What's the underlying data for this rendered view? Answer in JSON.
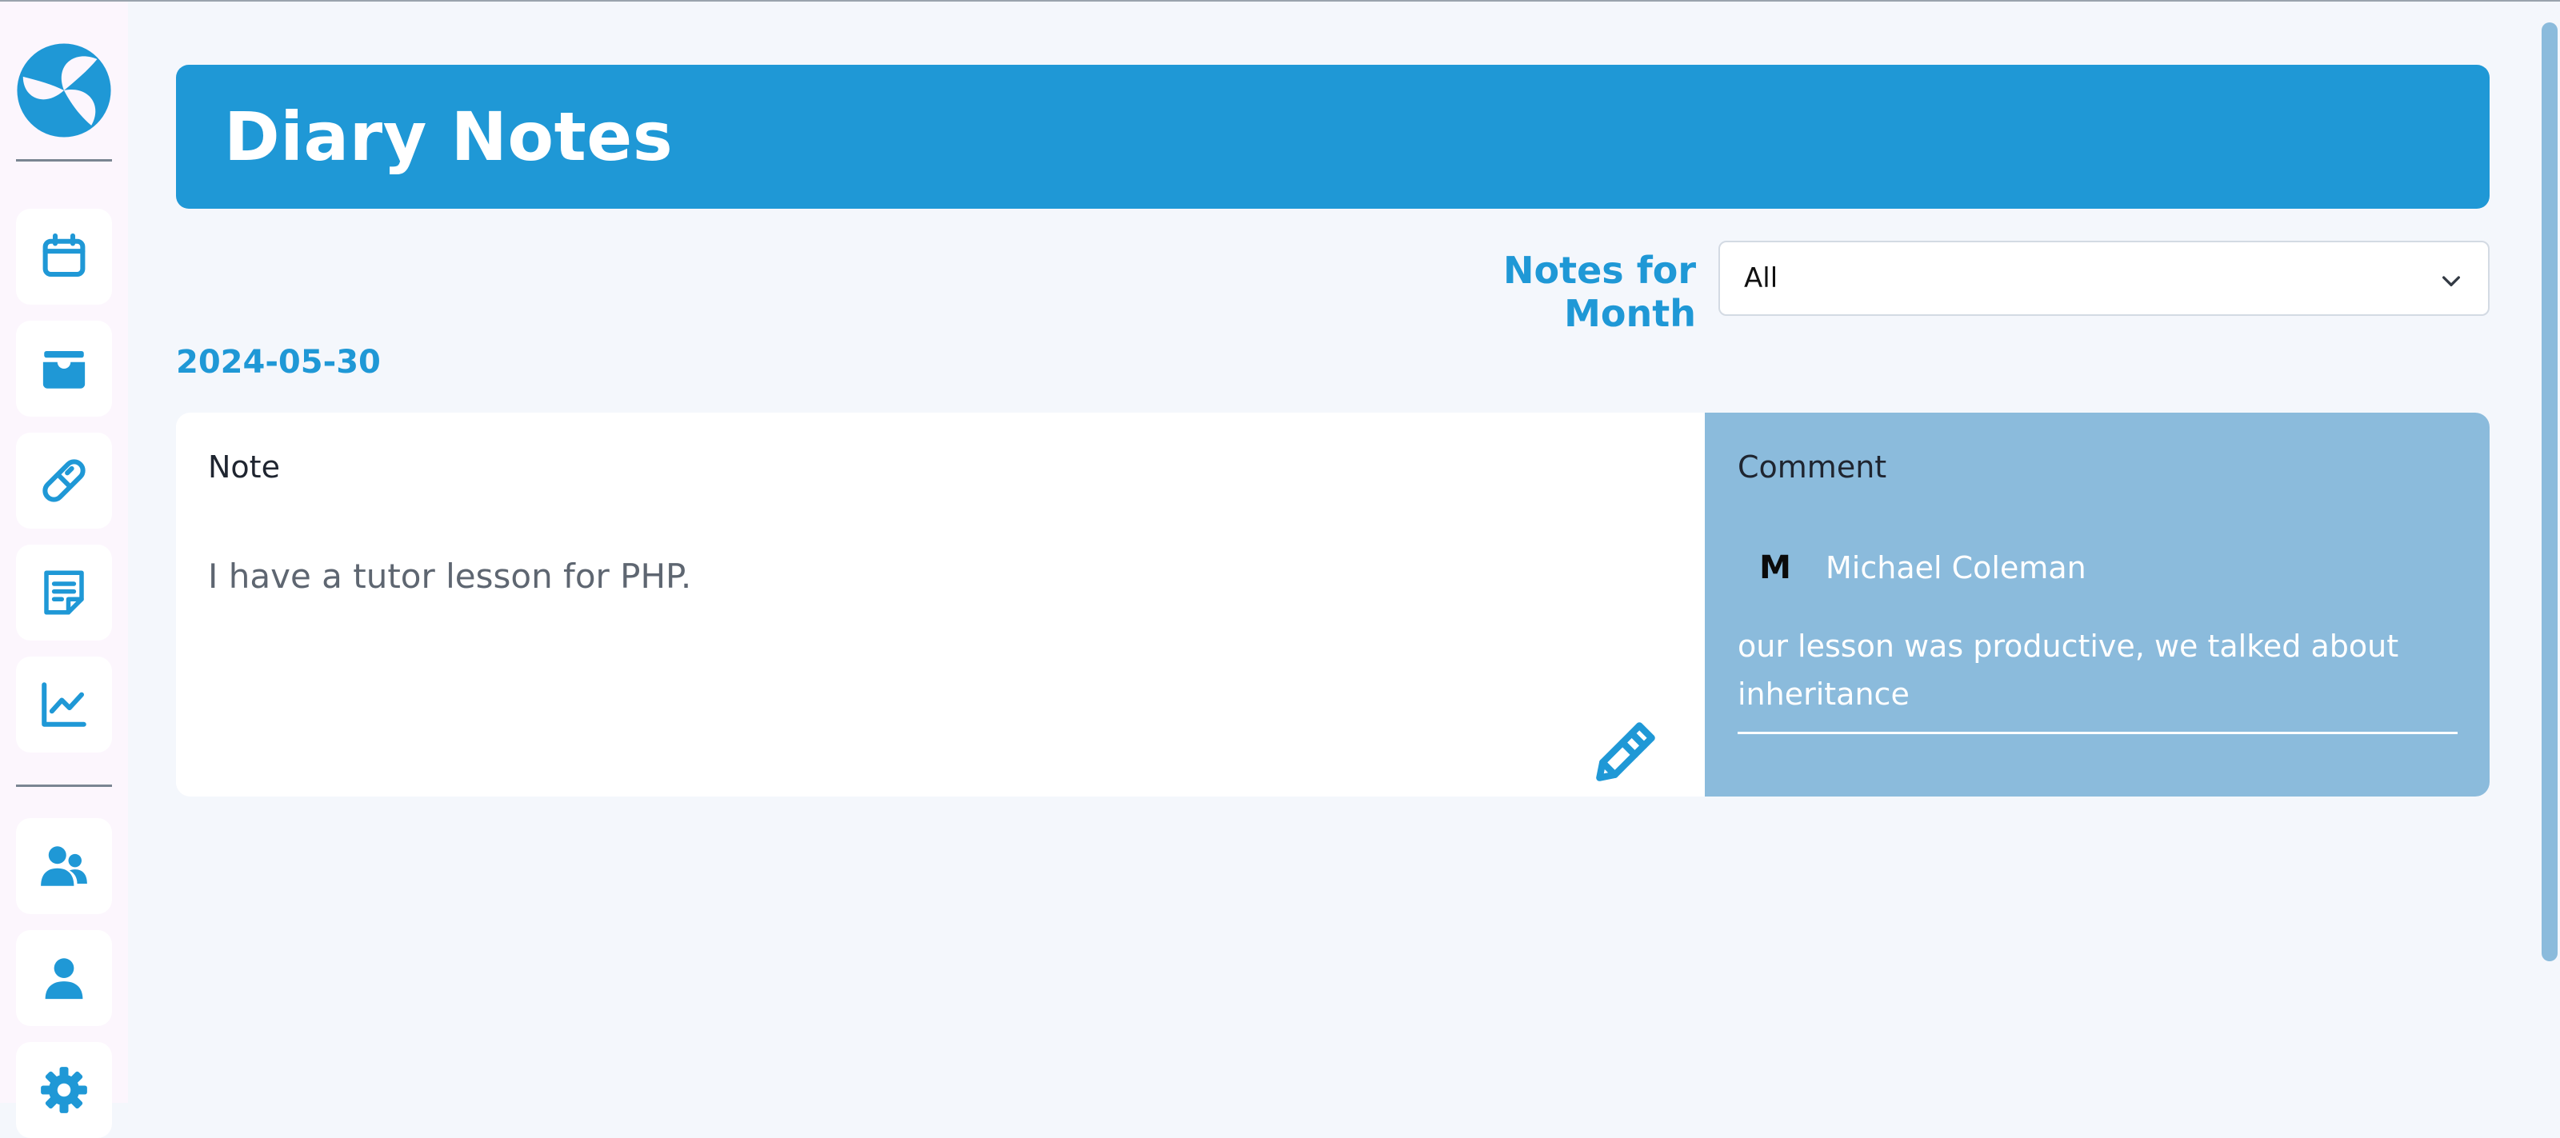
{
  "header": {
    "title": "Diary Notes"
  },
  "filter": {
    "label": "Notes for Month",
    "selected": "All"
  },
  "entries": [
    {
      "date": "2024-05-30",
      "note_heading": "Note",
      "note_text": "I have a tutor lesson for PHP.",
      "comment_heading": "Comment",
      "comment": {
        "avatar_initial": "M",
        "author": "Michael Coleman",
        "text": "our lesson was productive, we talked about inheritance"
      }
    }
  ],
  "sidebar": {
    "logo_icon": "swirl-logo-icon",
    "items": [
      {
        "icon": "calendar-icon"
      },
      {
        "icon": "inbox-tray-icon"
      },
      {
        "icon": "pill-icon"
      },
      {
        "icon": "note-icon"
      },
      {
        "icon": "line-chart-icon"
      },
      {
        "icon": "users-icon"
      },
      {
        "icon": "user-icon"
      },
      {
        "icon": "gear-icon"
      }
    ]
  },
  "colors": {
    "accent": "#1f98d6",
    "comment_bg": "#8bbbdc",
    "page_bg": "#f4f7fc",
    "sidebar_bg": "#fcf6fd"
  }
}
